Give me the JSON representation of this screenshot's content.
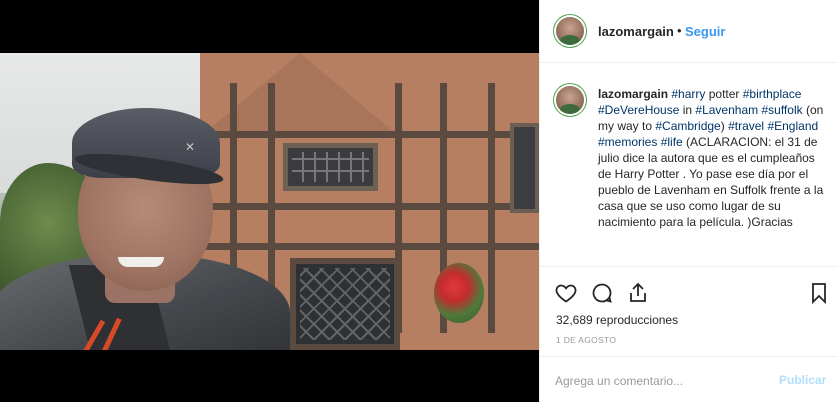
{
  "post": {
    "username": "lazomargain",
    "follow_label": "Seguir",
    "separator": "•"
  },
  "caption": {
    "username": "lazomargain",
    "parts": [
      {
        "type": "tag",
        "text": "#harry"
      },
      {
        "type": "text",
        "text": " potter "
      },
      {
        "type": "tag",
        "text": "#birthplace"
      },
      {
        "type": "text",
        "text": " "
      },
      {
        "type": "tag",
        "text": "#DeVereHouse"
      },
      {
        "type": "text",
        "text": " in "
      },
      {
        "type": "tag",
        "text": "#Lavenham"
      },
      {
        "type": "text",
        "text": " "
      },
      {
        "type": "tag",
        "text": "#suffolk"
      },
      {
        "type": "text",
        "text": " (on my way to "
      },
      {
        "type": "tag",
        "text": "#Cambridge"
      },
      {
        "type": "text",
        "text": ") "
      },
      {
        "type": "tag",
        "text": "#travel"
      },
      {
        "type": "text",
        "text": " "
      },
      {
        "type": "tag",
        "text": "#England"
      },
      {
        "type": "text",
        "text": " "
      },
      {
        "type": "tag",
        "text": "#memories"
      },
      {
        "type": "text",
        "text": " "
      },
      {
        "type": "tag",
        "text": "#life"
      },
      {
        "type": "text",
        "text": " (ACLARACION: el 31 de julio dice la autora que es el cumpleaños de Harry Potter . Yo pase ese día por el pueblo de Lavenham en Suffolk frente a la casa que se uso como lugar de su nacimiento para la película. )Gracias"
      }
    ]
  },
  "stats": {
    "views": "32,689 reproducciones",
    "date": "1 DE AGOSTO"
  },
  "comment_box": {
    "placeholder": "Agrega un comentario...",
    "publish_label": "Publicar"
  },
  "icons": [
    "heart-icon",
    "comment-icon",
    "share-icon",
    "bookmark-icon",
    "cap-logo-icon"
  ],
  "colors": {
    "link": "#3897f0",
    "hashtag": "#003569",
    "publish_disabled": "#b2dffc",
    "avatar_ring": "#4ca24c"
  }
}
